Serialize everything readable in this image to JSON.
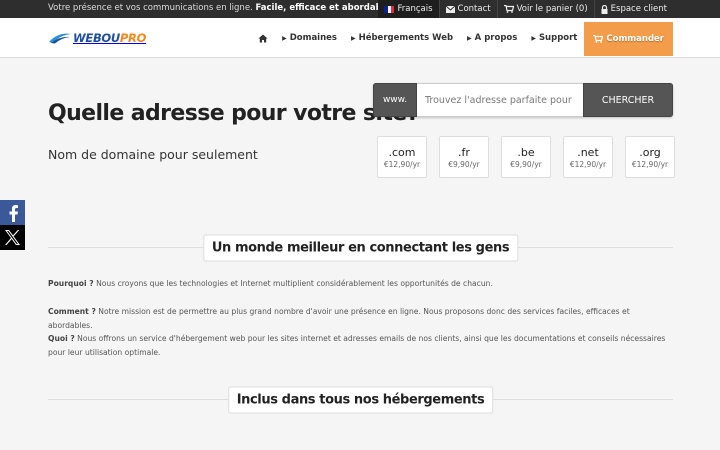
{
  "topbar": {
    "tagline_plain": "Votre présence et vos communications en ligne.",
    "tagline_bold": "Facile, efficace et abordable.",
    "language": "Français",
    "contact": "Contact",
    "cart": "Voir le panier (0)",
    "client_area": "Espace client"
  },
  "logo": {
    "part1": "WEBOU",
    "part2": "PRO"
  },
  "nav": {
    "domains": "Domaines",
    "hosting": "Hébergements Web",
    "about": "A propos",
    "support": "Support",
    "order": "Commander"
  },
  "hero": {
    "title": "Quelle adresse pour votre site?",
    "subtitle": "Nom de domaine pour seulement"
  },
  "search": {
    "prefix": "www.",
    "placeholder": "Trouvez l'adresse parfaite pour votre site",
    "button": "CHERCHER"
  },
  "tlds": [
    {
      "ext": ".com",
      "price": "€12,90/yr"
    },
    {
      "ext": ".fr",
      "price": "€9,90/yr"
    },
    {
      "ext": ".be",
      "price": "€9,90/yr"
    },
    {
      "ext": ".net",
      "price": "€12,90/yr"
    },
    {
      "ext": ".org",
      "price": "€12,90/yr"
    }
  ],
  "section1": {
    "heading": "Un monde meilleur en connectant les gens",
    "p1_label": "Pourquoi ?",
    "p1_text": " Nous croyons que les technologies et Internet multiplient considérablement les opportunités de chacun.",
    "p2_label": "Comment ?",
    "p2_text": " Notre mission est de permettre au plus grand nombre d'avoir une présence en ligne. Nous proposons donc des services faciles, efficaces et abordables.",
    "p3_label": "Quoi ?",
    "p3_text": " Nous offrons un service d'hébergement web pour les sites internet et adresses emails de nos clients, ainsi que les documentations et conseils nécessaires pour leur utilisation optimale."
  },
  "section2": {
    "heading": "Inclus dans tous nos hébergements"
  },
  "icons": {
    "home": "home-icon",
    "envelope": "envelope-icon",
    "cart": "cart-icon",
    "lock": "lock-icon",
    "facebook": "facebook-icon",
    "x": "x-icon"
  },
  "colors": {
    "brand_blue": "#1f4e9b",
    "brand_orange": "#f18a1e",
    "cta": "#f39c4a",
    "topbar": "#2e2e2e",
    "facebook": "#3b5998"
  }
}
